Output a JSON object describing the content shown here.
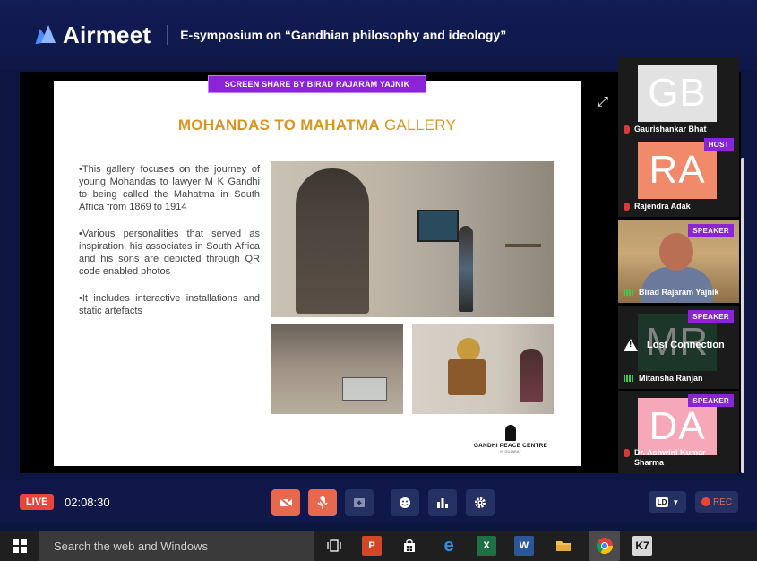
{
  "header": {
    "brand": "Airmeet",
    "event_title": "E-symposium on “Gandhian philosophy and ideology”"
  },
  "screen_share": {
    "label": "SCREEN SHARE BY BIRAD RAJARAM YAJNIK"
  },
  "slide": {
    "title_bold": "MOHANDAS TO MAHATMA",
    "title_light": " GALLERY",
    "bullets": [
      "•This gallery focuses on the journey of young Mohandas to lawyer M K Gandhi to being called the Mahatma in South Africa from 1869 to 1914",
      "•Various personalities that served as inspiration, his associates in South Africa and his sons are depicted through QR code enabled photos",
      "•It includes interactive installations and static artefacts"
    ],
    "logo_name": "GANDHI PEACE CENTRE",
    "logo_sub": "IN GUJARAT"
  },
  "participants": [
    {
      "initials": "GB",
      "name": "Gaurishankar Bhat",
      "role": "",
      "avatar_color": "#e2e2e2",
      "mic": "off"
    },
    {
      "initials": "RA",
      "name": "Rajendra Adak",
      "role": "HOST",
      "avatar_color": "#f08a6a",
      "mic": "off"
    },
    {
      "initials": "",
      "name": "Birad Rajaram Yajnik",
      "role": "SPEAKER",
      "avatar_color": "",
      "mic": "on",
      "video": true
    },
    {
      "initials": "MR",
      "name": "Mitansha Ranjan",
      "role": "SPEAKER",
      "avatar_color": "#1e5a3c",
      "mic": "on",
      "status": "Lost Connection"
    },
    {
      "initials": "DA",
      "name": "Dr. Ashwini Kumar Sharma",
      "role": "SPEAKER",
      "avatar_color": "#f7a8b8",
      "mic": "off"
    }
  ],
  "controls": {
    "live_label": "LIVE",
    "timer": "02:08:30",
    "quality_label": "LD",
    "rec_label": "REC",
    "buttons": [
      "video-off-icon",
      "mic-off-icon",
      "screen-share-icon",
      "emoji-icon",
      "poll-icon",
      "settings-icon"
    ]
  },
  "taskbar": {
    "search_placeholder": "Search the web and Windows",
    "apps": [
      "task-view-icon",
      "powerpoint-icon",
      "store-icon",
      "edge-icon",
      "excel-icon",
      "word-icon",
      "file-explorer-icon",
      "chrome-icon",
      "k7-icon"
    ]
  },
  "colors": {
    "brand_bg": "#0f1848",
    "accent_purple": "#8b24d6",
    "live_red": "#e8463c",
    "slide_title": "#d99520"
  }
}
